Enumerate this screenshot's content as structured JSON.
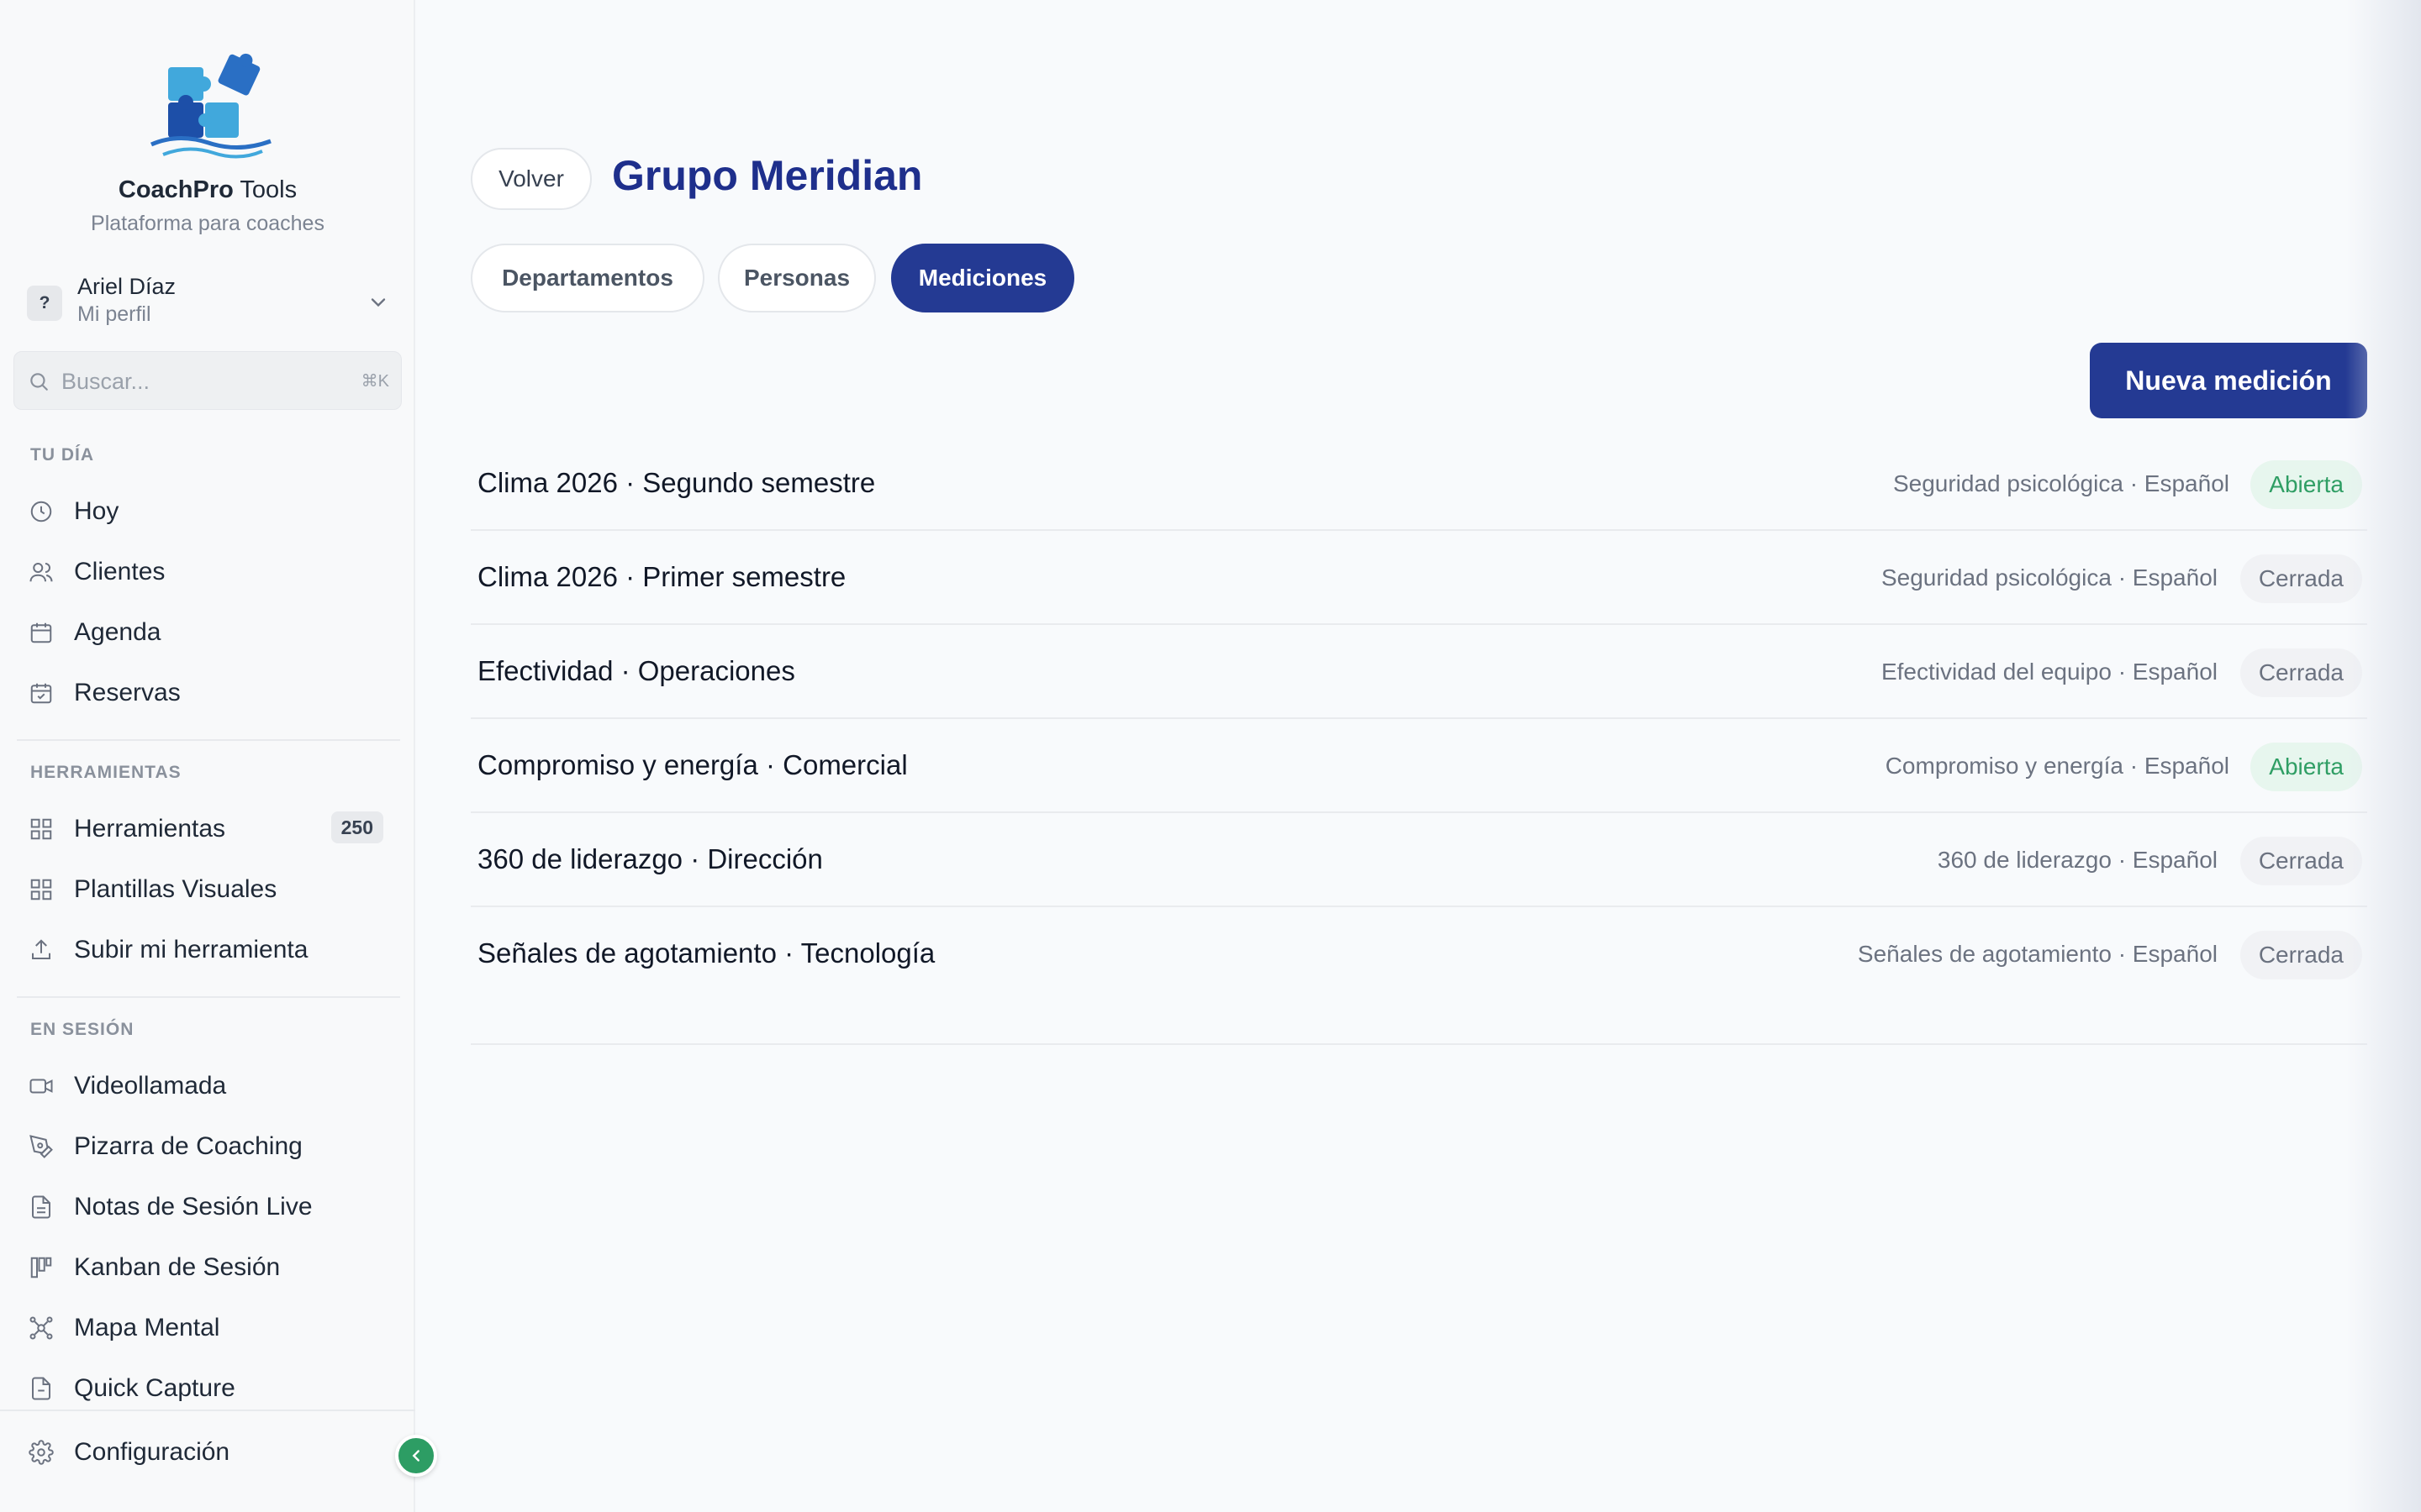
{
  "app": {
    "brand_bold": "CoachPro",
    "brand_rest": " Tools",
    "tagline": "Plataforma para coaches",
    "logo_icon": "puzzle-logo"
  },
  "profile": {
    "name": "Ariel Díaz",
    "subtitle": "Mi perfil",
    "avatar_text": "?"
  },
  "search": {
    "placeholder": "Buscar...",
    "shortcut": "⌘K"
  },
  "sidebar": {
    "sections": [
      {
        "heading": "TU DÍA",
        "items": [
          {
            "label": "Hoy",
            "icon": "clock-icon"
          },
          {
            "label": "Clientes",
            "icon": "users-icon"
          },
          {
            "label": "Agenda",
            "icon": "calendar-icon"
          },
          {
            "label": "Reservas",
            "icon": "calendar-check-icon"
          }
        ]
      },
      {
        "heading": "HERRAMIENTAS",
        "items": [
          {
            "label": "Herramientas",
            "icon": "grid-icon",
            "badge": "250"
          },
          {
            "label": "Plantillas Visuales",
            "icon": "grid-icon"
          },
          {
            "label": "Subir mi herramienta",
            "icon": "upload-icon"
          }
        ]
      },
      {
        "heading": "EN SESIÓN",
        "items": [
          {
            "label": "Videollamada",
            "icon": "video-icon"
          },
          {
            "label": "Pizarra de Coaching",
            "icon": "pen-tool-icon"
          },
          {
            "label": "Notas de Sesión Live",
            "icon": "file-text-icon"
          },
          {
            "label": "Kanban de Sesión",
            "icon": "kanban-icon"
          },
          {
            "label": "Mapa Mental",
            "icon": "mind-map-icon"
          },
          {
            "label": "Quick Capture",
            "icon": "file-icon"
          }
        ]
      }
    ],
    "footer": {
      "label": "Configuración",
      "icon": "gear-icon"
    }
  },
  "main": {
    "back_label": "Volver",
    "title": "Grupo Meridian",
    "tabs": [
      {
        "label": "Departamentos",
        "active": false
      },
      {
        "label": "Personas",
        "active": false
      },
      {
        "label": "Mediciones",
        "active": true
      }
    ],
    "new_button": "Nueva medición",
    "measurements": [
      {
        "title": "Clima 2026 · Segundo semestre",
        "meta": "Seguridad psicológica · Español",
        "status": "Abierta",
        "open": true
      },
      {
        "title": "Clima 2026 · Primer semestre",
        "meta": "Seguridad psicológica · Español",
        "status": "Cerrada",
        "open": false
      },
      {
        "title": "Efectividad · Operaciones",
        "meta": "Efectividad del equipo · Español",
        "status": "Cerrada",
        "open": false
      },
      {
        "title": "Compromiso y energía · Comercial",
        "meta": "Compromiso y energía · Español",
        "status": "Abierta",
        "open": true
      },
      {
        "title": "360 de liderazgo · Dirección",
        "meta": "360 de liderazgo · Español",
        "status": "Cerrada",
        "open": false
      },
      {
        "title": "Señales de agotamiento · Tecnología",
        "meta": "Señales de agotamiento · Español",
        "status": "Cerrada",
        "open": false
      }
    ]
  },
  "colors": {
    "primary": "#243a93",
    "title": "#1e2f8c",
    "open_bg": "#e7f6ee",
    "open_text": "#2f9e64",
    "toggle": "#2d9d64"
  }
}
